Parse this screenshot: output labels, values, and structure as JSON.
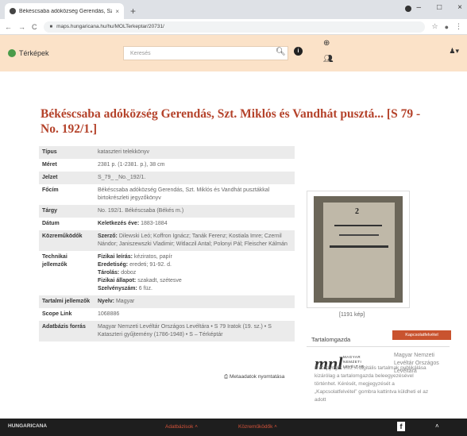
{
  "browser": {
    "tab_title": "Békéscsaba adóközség Gerendás, Szt. Miklós",
    "tab_close": "×",
    "new_tab": "+",
    "url": "maps.hungaricana.hu/hu/MOLTerkeptar/20731/",
    "window_controls": [
      "–",
      "□",
      "×"
    ]
  },
  "header": {
    "brand": "Térképek",
    "search_placeholder": "Keresés"
  },
  "page": {
    "title": "Békéscsaba adóközség Gerendás, Szt. Miklós és Vandhát pusztá... [S 79 - No. 192/1.]"
  },
  "meta_rows": [
    {
      "k": "Típus",
      "v": "kataszteri telekkönyv"
    },
    {
      "k": "Méret",
      "v": "2381 p. (1-2381. p.), 38 cm"
    },
    {
      "k": "Jelzet",
      "v": "S_79_ _No._192/1."
    },
    {
      "k": "Főcím",
      "v": "Békéscsaba adóközség Gerendás, Szt. Miklós és Vandhát pusztákkal birtokrészleti jegyzőkönyv"
    },
    {
      "k": "Tárgy",
      "v": "No. 192/1. Békéscsaba (Békés m.)"
    },
    {
      "k": "Dátum",
      "v_label": "Keletkezés éve:",
      "v": "1883-1884"
    },
    {
      "k": "Közreműködők",
      "v_label": "Szerző:",
      "v": "Dilewski Leó; Koffron Ignácz; Tanák Ferenz; Kostiala Imre; Czernil Nándor; Janiszewszki Vladimir; Witlaczil Antal; Polonyi Pál; Fleischer Kálmán"
    },
    {
      "k": "Technikai jellemzők",
      "lines": [
        {
          "label": "Fizikai leírás:",
          "v": "kéziratos, papír"
        },
        {
          "label": "Eredetiség:",
          "v": "eredeti; 91-92. d."
        },
        {
          "label": "Tárolás:",
          "v": "doboz"
        },
        {
          "label": "Fizikai állapot:",
          "v": "szakadt, szétesve"
        },
        {
          "label": "Szelvényszám:",
          "v": "6 füz."
        }
      ]
    },
    {
      "k": "Tartalmi jellemzők",
      "v_label": "Nyelv:",
      "v": "Magyar"
    },
    {
      "k": "Scope Link",
      "v": "1068886"
    },
    {
      "k": "Adatbázis forrás",
      "v": "Magyar Nemzeti Levéltár Országos Levéltára • S 79 Iratok (19. sz.) • S Kataszteri gyűjtemény (1786-1948) • S – Térképtár"
    }
  ],
  "thumbnail": {
    "number": "2",
    "count": "[1191 kép]"
  },
  "sidebar": {
    "title": "Tartalomgazda",
    "logo_text": "mnl",
    "logo_sub": [
      "MAGYAR",
      "NEMZETI",
      "LEVÉLTÁR"
    ],
    "org_name": "Magyar Nemzeti Levéltár Országos Levéltára",
    "contact": "Kapcsolatfelvétel"
  },
  "copyright": "© Copyright Info: A digitális tartalmak publikálása kizárólag a tartalomgazda beleegyezésével történhet. Kérését, megjegyzését a „Kapcsolatfelvétel” gombra kattintva küldheti el az adott",
  "print_label": "Metaadatok nyomtatása",
  "footer": {
    "brand": "HUNGARICANA",
    "link1": "Adatbázisok",
    "link2": "Közreműködők",
    "fb": "f"
  }
}
